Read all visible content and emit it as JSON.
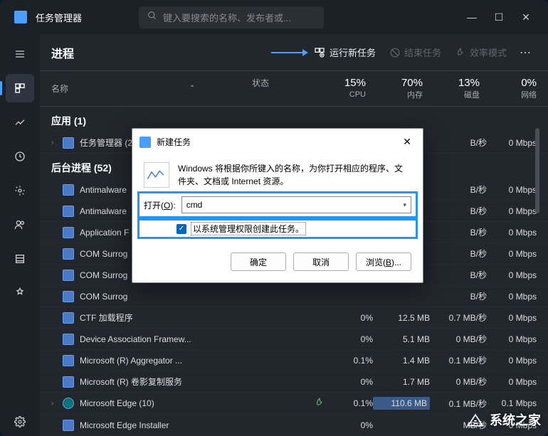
{
  "titlebar": {
    "title": "任务管理器",
    "search_placeholder": "键入要搜索的名称、发布者或..."
  },
  "toolbar": {
    "page_title": "进程",
    "run_new_task": "运行新任务",
    "end_task": "结束任务",
    "efficiency_mode": "效率模式"
  },
  "columns": {
    "name": "名称",
    "status": "状态",
    "cpu": {
      "val": "15%",
      "label": "CPU"
    },
    "mem": {
      "val": "70%",
      "label": "内存"
    },
    "disk": {
      "val": "13%",
      "label": "磁盘"
    },
    "net": {
      "val": "0%",
      "label": "网络"
    }
  },
  "sections": {
    "apps": "应用 (1)",
    "background": "后台进程 (52)"
  },
  "processes": [
    {
      "name": "任务管理器 (2)",
      "expand": true,
      "cpu": "",
      "mem": "",
      "disk": "B/秒",
      "net": "0 Mbps"
    },
    {
      "name": "Antimalware",
      "cpu": "",
      "mem": "",
      "disk": "B/秒",
      "net": "0 Mbps"
    },
    {
      "name": "Antimalware",
      "cpu": "",
      "mem": "",
      "disk": "B/秒",
      "net": "0 Mbps"
    },
    {
      "name": "Application F",
      "cpu": "",
      "mem": "",
      "disk": "B/秒",
      "net": "0 Mbps"
    },
    {
      "name": "COM Surrog",
      "cpu": "",
      "mem": "",
      "disk": "B/秒",
      "net": "0 Mbps"
    },
    {
      "name": "COM Surrog",
      "cpu": "",
      "mem": "",
      "disk": "B/秒",
      "net": "0 Mbps"
    },
    {
      "name": "COM Surrog",
      "cpu": "",
      "mem": "",
      "disk": "B/秒",
      "net": "0 Mbps"
    },
    {
      "name": "CTF 加载程序",
      "cpu": "0%",
      "mem": "12.5 MB",
      "disk": "0.7 MB/秒",
      "net": "0 Mbps"
    },
    {
      "name": "Device Association Framew...",
      "cpu": "0%",
      "mem": "5.1 MB",
      "disk": "0 MB/秒",
      "net": "0 Mbps"
    },
    {
      "name": "Microsoft (R) Aggregator ...",
      "cpu": "0.1%",
      "mem": "1.4 MB",
      "disk": "0.1 MB/秒",
      "net": "0 Mbps"
    },
    {
      "name": "Microsoft (R) 卷影复制服务",
      "cpu": "0%",
      "mem": "1.7 MB",
      "disk": "0 MB/秒",
      "net": "0 Mbps"
    },
    {
      "name": "Microsoft Edge (10)",
      "expand": true,
      "edge": true,
      "leaf": true,
      "cpu": "0.1%",
      "mem": "110.6 MB",
      "memhot": true,
      "disk": "0.1 MB/秒",
      "net": "0.1 Mbps"
    },
    {
      "name": "Microsoft Edge Installer",
      "cpu": "0%",
      "mem": "",
      "disk": "MB/秒",
      "net": "0 Mbps"
    }
  ],
  "dialog": {
    "title": "新建任务",
    "description": "Windows 将根据你所键入的名称，为你打开相应的程序、文件夹、文档或 Internet 资源。",
    "open_label_pre": "打开(",
    "open_label_u": "O",
    "open_label_post": "):",
    "input_value": "cmd",
    "admin_checkbox": "以系统管理权限创建此任务。",
    "ok": "确定",
    "cancel": "取消",
    "browse_pre": "浏览(",
    "browse_u": "B",
    "browse_post": ")..."
  },
  "watermark": "系统之家"
}
